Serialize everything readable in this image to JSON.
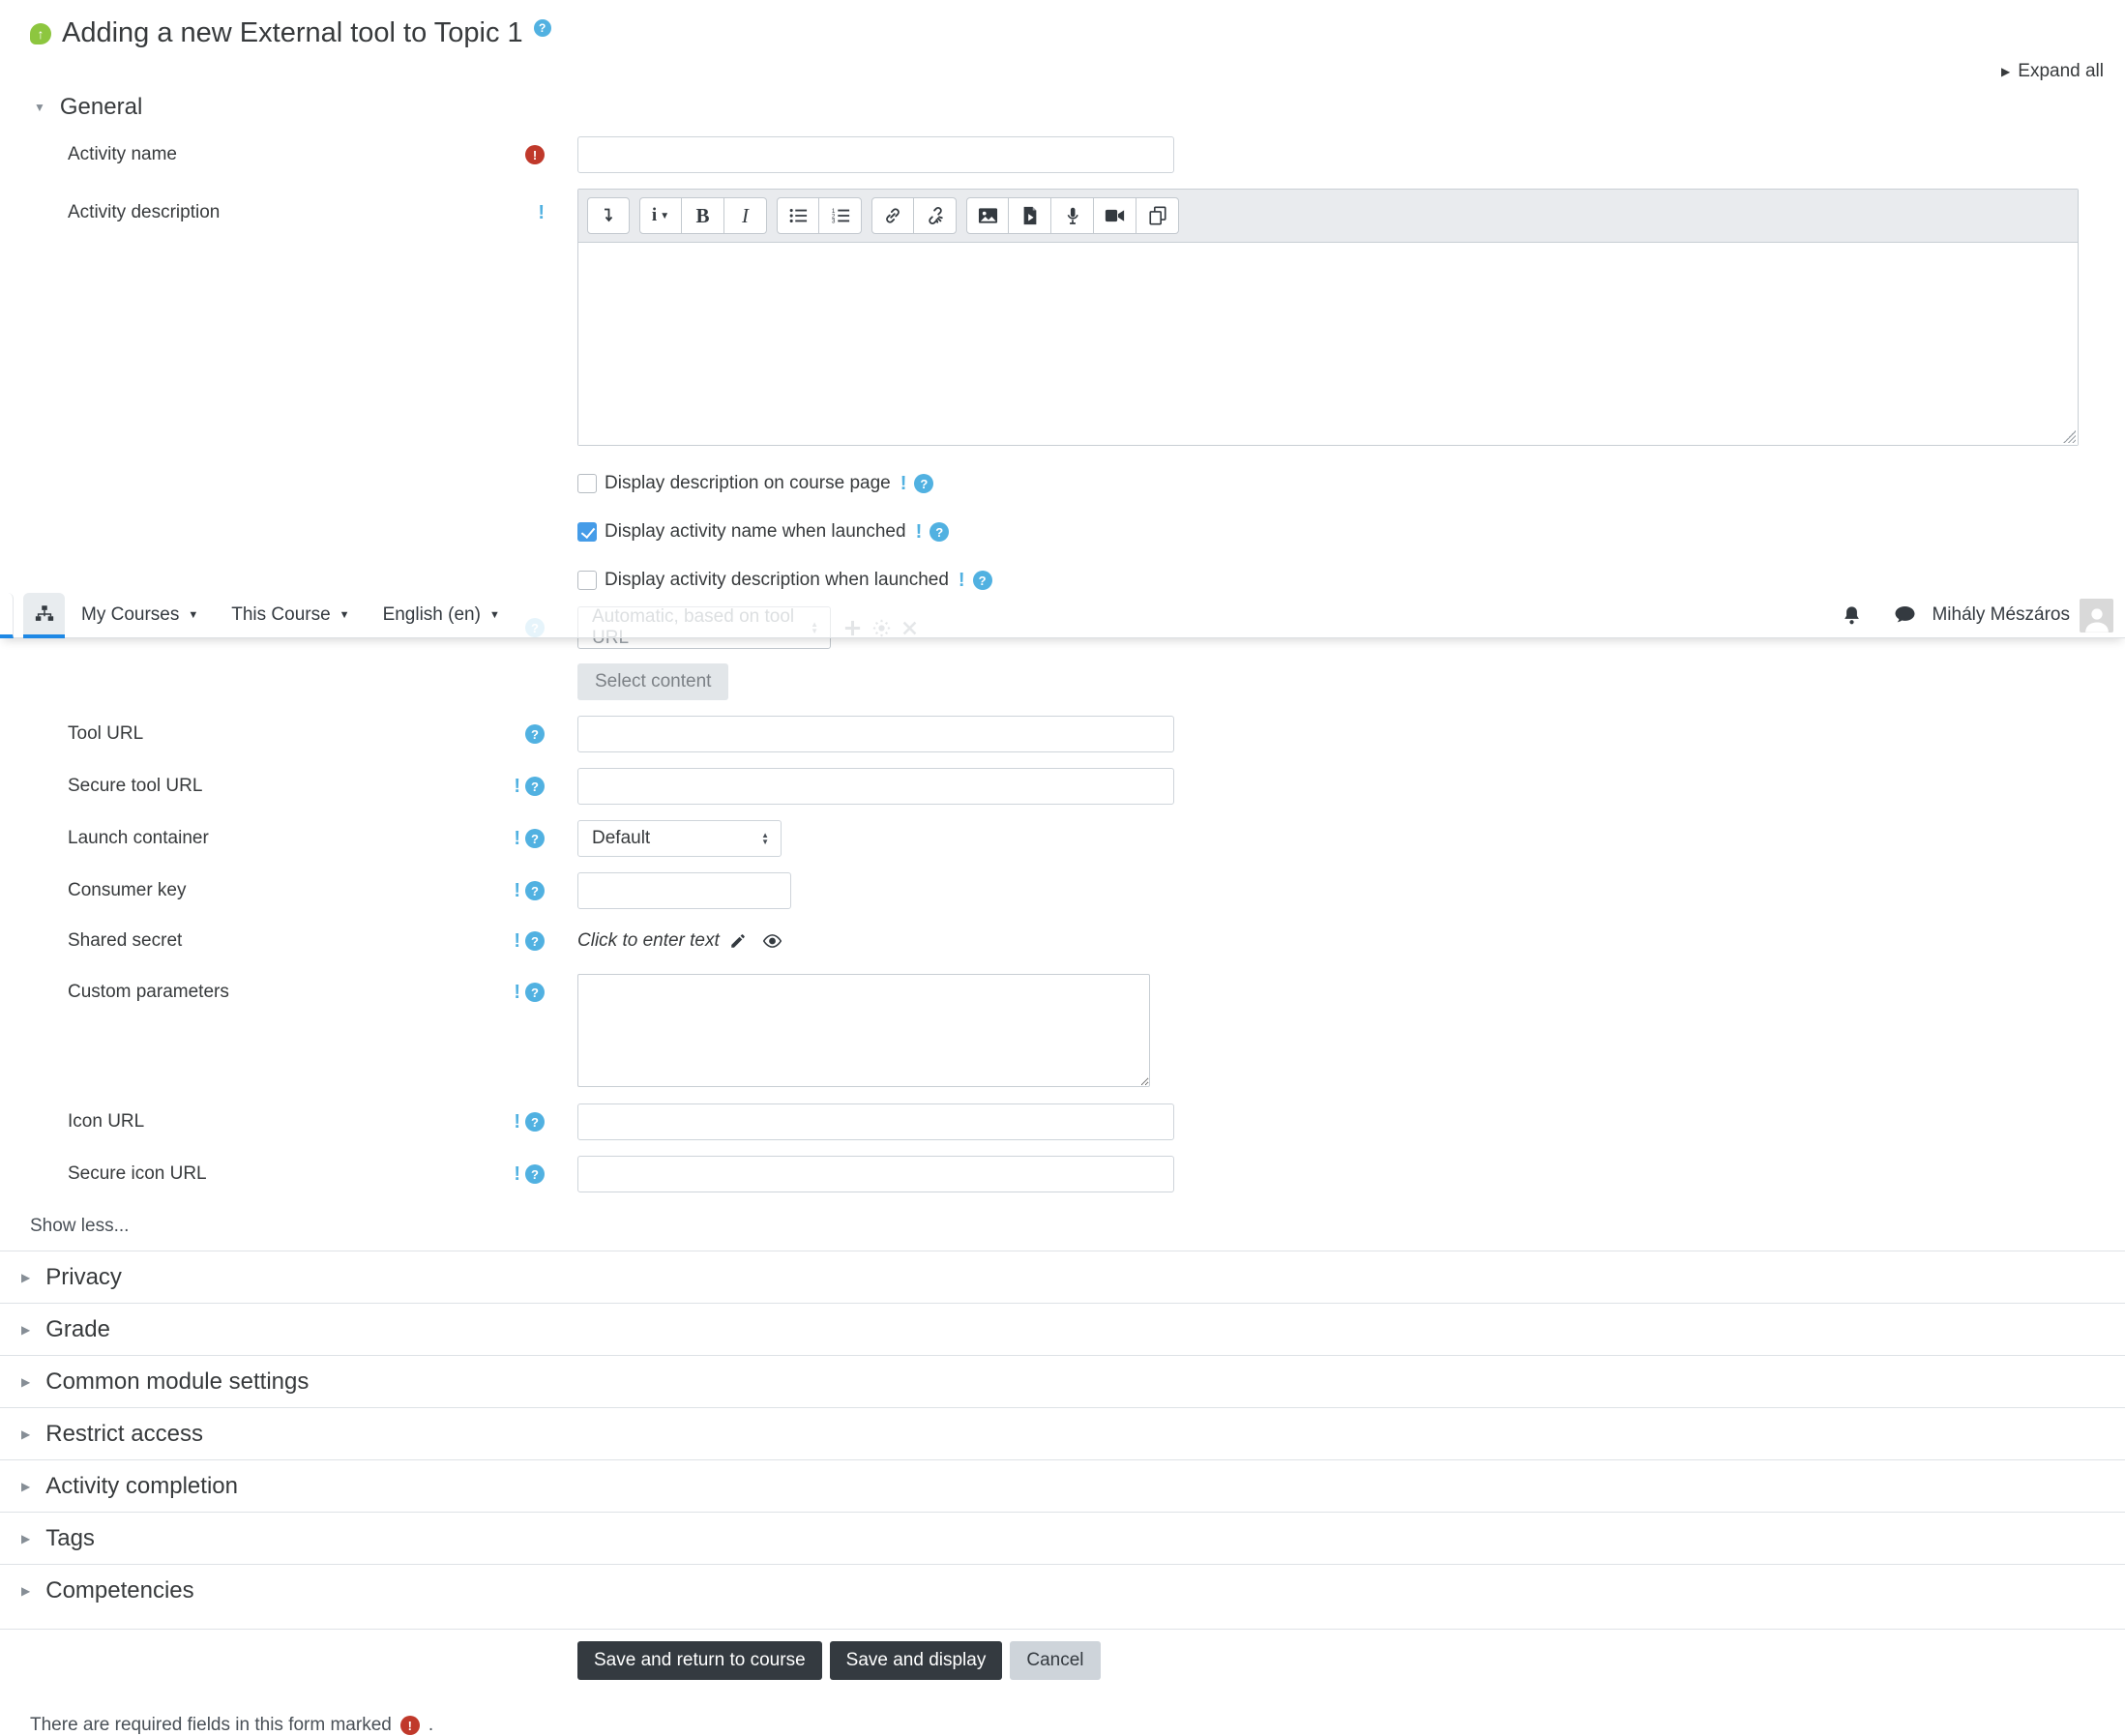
{
  "colors": {
    "primary_blue": "#1e88e5",
    "info_blue": "#51b1e1",
    "danger_red": "#c0392b",
    "activity_green": "#8dc63f",
    "button_dark": "#343a40",
    "checkbox_checked": "#459ce8"
  },
  "header": {
    "title": "Adding a new External tool to Topic 1",
    "expand_all": "Expand all"
  },
  "navbar": {
    "menus": [
      "My Courses",
      "This Course",
      "English (en)"
    ],
    "user_name": "Mihály Mészáros",
    "icons": [
      "sitemap-icon",
      "bell-icon",
      "chat-icon",
      "avatar"
    ]
  },
  "general": {
    "heading": "General",
    "activity_name_label": "Activity name",
    "activity_description_label": "Activity description",
    "checkboxes": [
      {
        "label": "Display description on course page",
        "checked": false
      },
      {
        "label": "Display activity name when launched",
        "checked": true
      },
      {
        "label": "Display activity description when launched",
        "checked": false
      }
    ],
    "preconfigured_tool_value": "Automatic, based on tool URL",
    "select_content_label": "Select content",
    "tool_url_label": "Tool URL",
    "secure_tool_url_label": "Secure tool URL",
    "launch_container_label": "Launch container",
    "launch_container_value": "Default",
    "consumer_key_label": "Consumer key",
    "shared_secret_label": "Shared secret",
    "shared_secret_value": "Click to enter text",
    "custom_parameters_label": "Custom parameters",
    "icon_url_label": "Icon URL",
    "secure_icon_url_label": "Secure icon URL",
    "show_less": "Show less..."
  },
  "editor": {
    "styles_glyph": "i",
    "bold_glyph": "B",
    "italic_glyph": "I",
    "toolbar_icons": [
      "collapse-toolbar",
      "paragraph-styles",
      "bold",
      "italic",
      "unordered-list",
      "ordered-list",
      "link",
      "unlink",
      "insert-image",
      "insert-media",
      "record-audio",
      "record-video",
      "manage-files"
    ]
  },
  "sections": [
    "Privacy",
    "Grade",
    "Common module settings",
    "Restrict access",
    "Activity completion",
    "Tags",
    "Competencies"
  ],
  "actions": {
    "save_return": "Save and return to course",
    "save_display": "Save and display",
    "cancel": "Cancel"
  },
  "footer": {
    "required_note": "There are required fields in this form marked",
    "required_note_suffix": "."
  },
  "badges": {
    "help": "?",
    "required": "!",
    "advanced": "!"
  }
}
